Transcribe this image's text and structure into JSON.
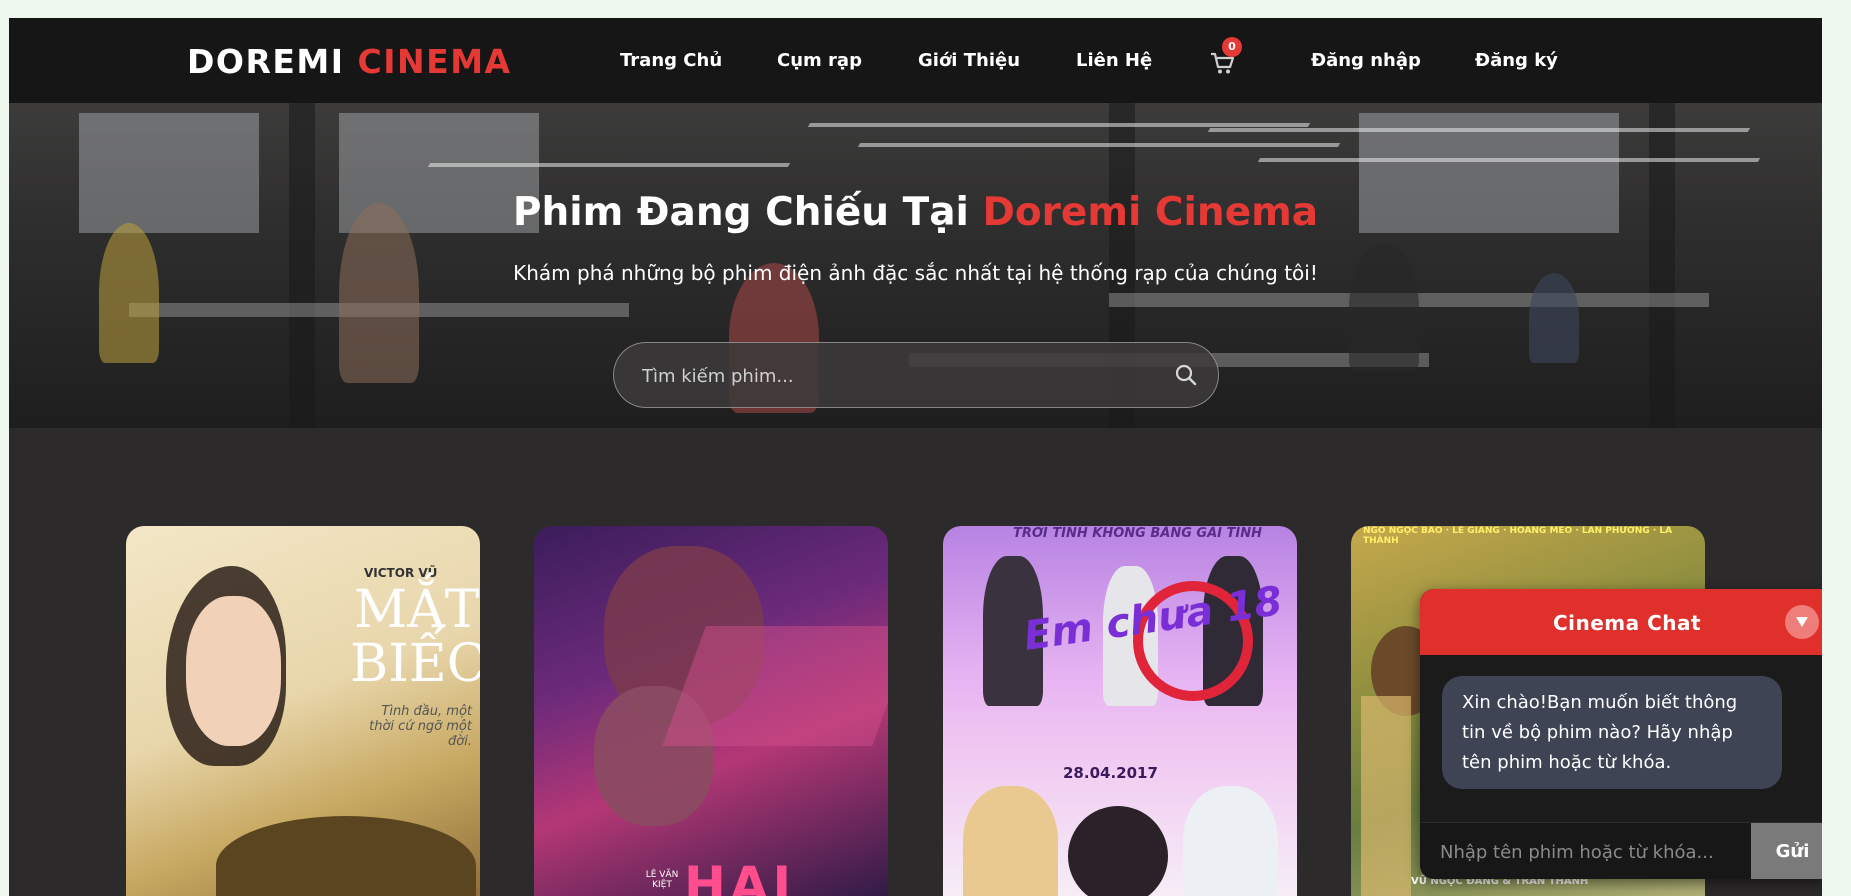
{
  "brand": {
    "part1": "DOREMI",
    "part2": "CINEMA"
  },
  "nav": {
    "items": [
      {
        "label": "Trang Chủ"
      },
      {
        "label": "Cụm rạp"
      },
      {
        "label": "Giới Thiệu"
      },
      {
        "label": "Liên Hệ"
      }
    ],
    "cart_count": "0",
    "login": "Đăng nhập",
    "register": "Đăng ký"
  },
  "hero": {
    "title_prefix": "Phim Đang Chiếu Tại",
    "title_highlight": "Doremi Cinema",
    "subtitle": "Khám phá những bộ phim điện ảnh đặc sắc nhất tại hệ thống rạp của chúng tôi!",
    "search_placeholder": "Tìm kiếm phim..."
  },
  "movies": [
    {
      "name": "mat-biec",
      "credit": "VICTOR VŨ",
      "title_line1": "MẮT",
      "title_line2": "BIẾC",
      "tagline": "Tình đầu, một thời cứ ngỡ một đời."
    },
    {
      "name": "hai-phuong",
      "title": "HAI",
      "credit": "LÊ VĂN KIỆT"
    },
    {
      "name": "em-chua-18",
      "title": "Em chưa 18",
      "number": "18",
      "date": "28.04.2017",
      "top_text": "TRỜI TÍNH KHÔNG BẰNG GÁI TÍNH"
    },
    {
      "name": "movie-4",
      "actors": "NGÔ NGỌC BẢO · LÊ GIANG · HOÀNG MEO · LAN PHƯƠNG · LA THÀNH",
      "bottom": "VŨ NGỌC ĐÃNG & TRẦN THANH"
    }
  ],
  "chat": {
    "title": "Cinema Chat",
    "greeting": "Xin chào!Bạn muốn biết thông tin về bộ phim nào? Hãy nhập tên phim hoặc từ khóa.",
    "input_placeholder": "Nhập tên phim hoặc từ khóa...",
    "send_label": "Gửi"
  },
  "colors": {
    "accent": "#e53935",
    "navbar": "#171616",
    "body": "#2d2a2b",
    "chat_bubble": "#3f4455"
  }
}
